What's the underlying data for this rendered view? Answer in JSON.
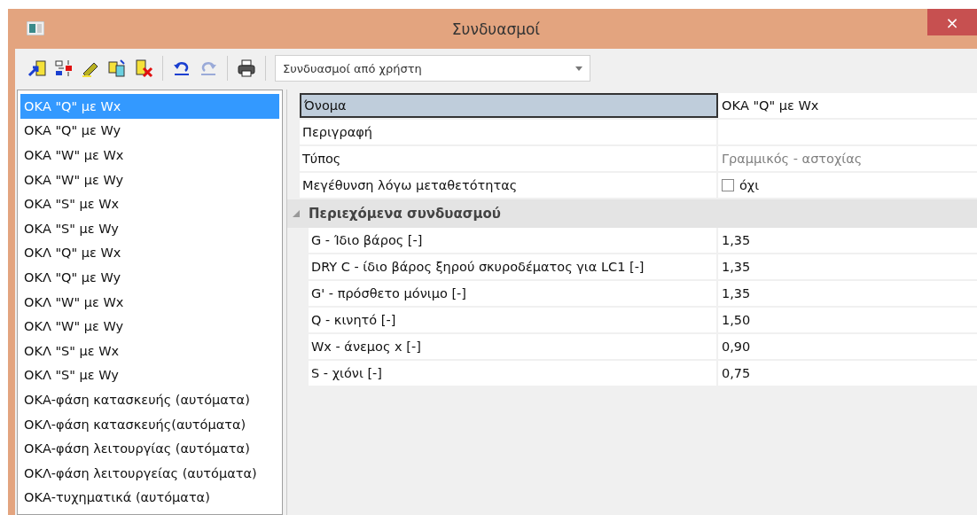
{
  "window": {
    "title": "Συνδυασμοί",
    "close": "×"
  },
  "toolbar": {
    "dropdown": {
      "value": "Συνδυασμοί από χρήστη"
    }
  },
  "list": [
    {
      "label": "ΟΚΑ \"Q\" με Wx",
      "selected": true
    },
    {
      "label": "ΟΚΑ \"Q\" με Wy",
      "selected": false
    },
    {
      "label": "ΟΚΑ \"W\" με Wx",
      "selected": false
    },
    {
      "label": "ΟΚΑ \"W\" με Wy",
      "selected": false
    },
    {
      "label": "ΟΚΑ \"S\" με Wx",
      "selected": false
    },
    {
      "label": "ΟΚΑ \"S\" με Wy",
      "selected": false
    },
    {
      "label": "ΟΚΛ \"Q\" με Wx",
      "selected": false
    },
    {
      "label": "ΟΚΛ \"Q\" με Wy",
      "selected": false
    },
    {
      "label": "ΟΚΛ \"W\" με Wx",
      "selected": false
    },
    {
      "label": "ΟΚΛ \"W\" με Wy",
      "selected": false
    },
    {
      "label": "ΟΚΛ \"S\" με Wx",
      "selected": false
    },
    {
      "label": "ΟΚΛ \"S\" με Wy",
      "selected": false
    },
    {
      "label": "ΟΚΑ-φάση κατασκευής (αυτόματα)",
      "selected": false
    },
    {
      "label": "ΟΚΛ-φάση κατασκευής(αυτόματα)",
      "selected": false
    },
    {
      "label": "ΟΚΑ-φάση λειτουργίας (αυτόματα)",
      "selected": false
    },
    {
      "label": "ΟΚΛ-φάση λειτουργείας (αυτόματα)",
      "selected": false
    },
    {
      "label": "ΟΚΑ-τυχηματικά (αυτόματα)",
      "selected": false
    }
  ],
  "properties": [
    {
      "kind": "text",
      "label": "Όνομα",
      "value": "ΟΚΑ \"Q\" με Wx",
      "selected": true
    },
    {
      "kind": "text",
      "label": "Περιγραφή",
      "selected": false
    },
    {
      "kind": "readonly",
      "label": "Τύπος",
      "value": "Γραμμικός - αστοχίας",
      "selected": false
    },
    {
      "kind": "checkbox",
      "label": "Μεγέθυνση λόγω μεταθετότητας",
      "value": "όχι",
      "checked": false,
      "selected": false
    },
    {
      "kind": "section",
      "label": "Περιεχόμενα συνδυασμού",
      "expanded": true,
      "children": [
        {
          "kind": "text",
          "label": "G - Ίδιο βάρος [-]",
          "value": "1,35",
          "selected": false
        },
        {
          "kind": "text",
          "label": "DRY C - ίδιο βάρος ξηρού σκυροδέματος για LC1 [-]",
          "value": "1,35",
          "selected": false
        },
        {
          "kind": "text",
          "label": "G' - πρόσθετο μόνιμο [-]",
          "value": "1,35",
          "selected": false
        },
        {
          "kind": "text",
          "label": "Q - κινητό [-]",
          "value": "1,50",
          "selected": false
        },
        {
          "kind": "text",
          "label": "Wx - άνεμος x [-]",
          "value": "0,90",
          "selected": false
        },
        {
          "kind": "text",
          "label": "S - χιόνι [-]",
          "value": "0,75",
          "selected": false
        }
      ]
    }
  ]
}
